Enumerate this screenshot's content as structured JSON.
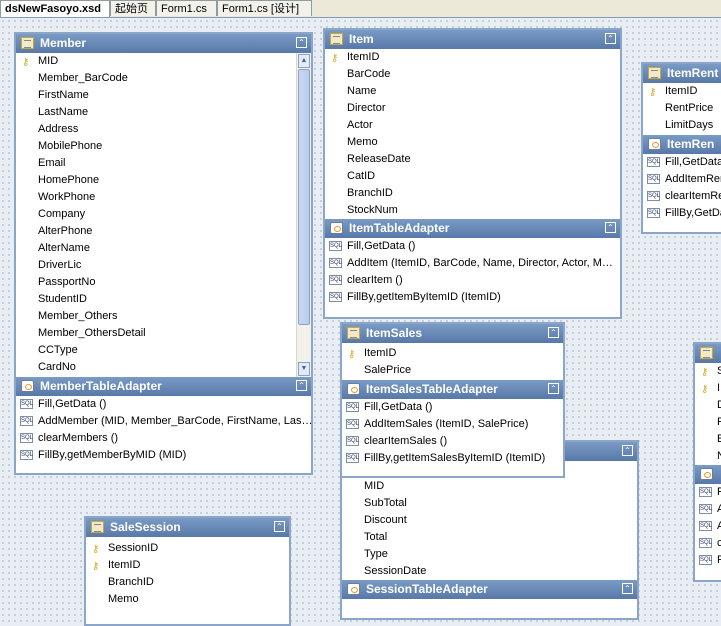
{
  "tabs": [
    {
      "label": "dsNewFasoyo.xsd",
      "active": true
    },
    {
      "label": "起始页",
      "active": false
    },
    {
      "label": "Form1.cs",
      "active": false
    },
    {
      "label": "Form1.cs [设计]",
      "active": false
    }
  ],
  "collapse_glyph": "⌃",
  "key_glyph": "⚷",
  "sql_glyph": "SQL",
  "member": {
    "title": "Member",
    "fields": [
      "MID",
      "Member_BarCode",
      "FirstName",
      "LastName",
      "Address",
      "MobilePhone",
      "Email",
      "HomePhone",
      "WorkPhone",
      "Company",
      "AlterPhone",
      "AlterName",
      "DriverLic",
      "PassportNo",
      "StudentID",
      "Member_Others",
      "Member_OthersDetail",
      "CCType",
      "CardNo"
    ],
    "adapter_title": "MemberTableAdapter",
    "methods": [
      "Fill,GetData ()",
      "AddMember (MID, Member_BarCode, FirstName, Las…",
      "clearMembers ()",
      "FillBy,getMemberByMID (MID)"
    ]
  },
  "item": {
    "title": "Item",
    "fields": [
      "ItemID",
      "BarCode",
      "Name",
      "Director",
      "Actor",
      "Memo",
      "ReleaseDate",
      "CatID",
      "BranchID",
      "StockNum"
    ],
    "adapter_title": "ItemTableAdapter",
    "methods": [
      "Fill,GetData ()",
      "AddItem (ItemID, BarCode, Name, Director, Actor, M…",
      "clearItem ()",
      "FillBy,getItemByItemID (ItemID)"
    ]
  },
  "itemrent": {
    "title": "ItemRent",
    "fields": [
      "ItemID",
      "RentPrice",
      "LimitDays"
    ],
    "adapter_title": "ItemRen",
    "methods": [
      "Fill,GetData",
      "AddItemRen",
      "clearItemRe",
      "FillBy,GetDa"
    ]
  },
  "itemsales": {
    "title": "ItemSales",
    "fields": [
      "ItemID",
      "SalePrice"
    ],
    "adapter_title": "ItemSalesTableAdapter",
    "methods": [
      "Fill,GetData ()",
      "AddItemSales (ItemID, SalePrice)",
      "clearItemSales ()",
      "FillBy,getItemSalesByItemID (ItemID)"
    ]
  },
  "session": {
    "fields": [
      "MID",
      "SubTotal",
      "Discount",
      "Total",
      "Type",
      "SessionDate"
    ],
    "adapter_title": "SessionTableAdapter"
  },
  "salesession": {
    "title": "SaleSession",
    "fields": [
      "SessionID",
      "ItemID",
      "BranchID",
      "Memo"
    ]
  },
  "right_partial": {
    "fields": [
      "S",
      "I",
      "D",
      "F",
      "E",
      "N"
    ],
    "methods": [
      "F",
      "A",
      "A",
      "c",
      "F"
    ]
  }
}
